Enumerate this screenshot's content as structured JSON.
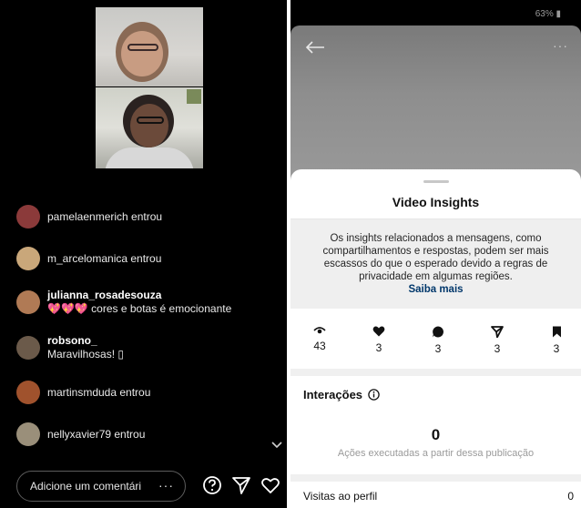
{
  "live": {
    "chat": [
      {
        "type": "join",
        "text": "pamelaenmerich entrou",
        "avatar_color": "#8b3a3a"
      },
      {
        "type": "join",
        "text": "m_arcelomanica entrou",
        "avatar_color": "#c9a77a"
      },
      {
        "type": "comment",
        "user": "julianna_rosadesouza",
        "message": "💖💖💖 cores e botas é emocionante",
        "avatar_color": "#b07a55"
      },
      {
        "type": "comment",
        "user": "robsono_",
        "message": "Maravilhosas! ▯",
        "avatar_color": "#6b5a4a"
      },
      {
        "type": "join",
        "text": "martinsmduda entrou",
        "avatar_color": "#a0522d"
      },
      {
        "type": "join",
        "text": "nellyxavier79 entrou",
        "avatar_color": "#9a8f7a"
      }
    ],
    "comment_placeholder": "Adicione um comentári",
    "comment_more": "···"
  },
  "status": {
    "battery": "63% ▮"
  },
  "insights": {
    "title": "Video Insights",
    "notice": "Os insights relacionados a mensagens, como compartilhamentos e respostas, podem ser mais escassos do que o esperado devido a regras de privacidade em algumas regiões.",
    "notice_link": "Saiba mais",
    "metrics": [
      {
        "icon": "eye-icon",
        "value": "43"
      },
      {
        "icon": "heart-icon",
        "value": "3"
      },
      {
        "icon": "comment-icon",
        "value": "3"
      },
      {
        "icon": "send-icon",
        "value": "3"
      },
      {
        "icon": "bookmark-icon",
        "value": "3"
      }
    ],
    "interactions_label": "Interações",
    "actions_count": "0",
    "actions_label": "Ações executadas a partir dessa publicação",
    "visits_label": "Visitas ao perfil",
    "visits_value": "0"
  },
  "top_more": "···"
}
